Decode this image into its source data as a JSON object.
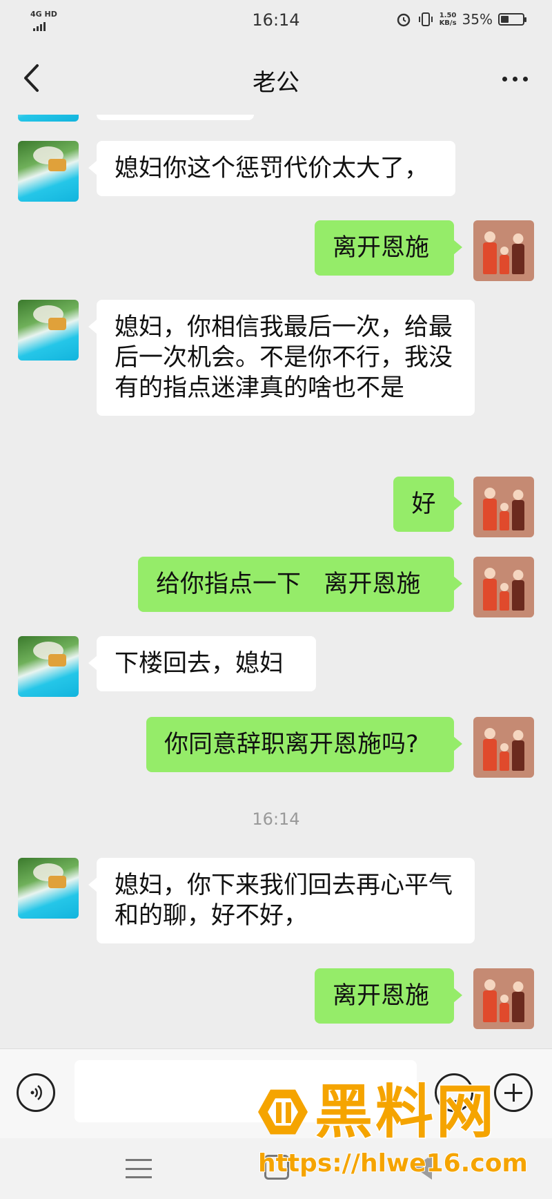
{
  "status_bar": {
    "network": "4G HD",
    "time": "16:14",
    "speed": "1.50\nKB/s",
    "battery": "35%",
    "battery_level": 0.35
  },
  "header": {
    "title": "老公"
  },
  "messages": [
    {
      "sender": "husband",
      "text": "媳妇你这个惩罚代价太大了，"
    },
    {
      "sender": "me",
      "text": "离开恩施"
    },
    {
      "sender": "husband",
      "text": "媳妇，你相信我最后一次，给最后一次机会。不是你不行，我没有的指点迷津真的啥也不是"
    },
    {
      "sender": "me",
      "text": "好"
    },
    {
      "sender": "me",
      "text": "给你指点一下   离开恩施"
    },
    {
      "sender": "husband",
      "text": "下楼回去，媳妇"
    },
    {
      "sender": "me",
      "text": "你同意辞职离开恩施吗?"
    },
    {
      "sender": "husband",
      "text": "媳妇，你下来我们回去再心平气和的聊，好不好，"
    },
    {
      "sender": "me",
      "text": "离开恩施"
    }
  ],
  "timestamp": "16:14",
  "input": {
    "value": ""
  },
  "watermark": {
    "title": "黑料网",
    "url": "https://hlwe16.com"
  },
  "colors": {
    "background": "#ededed",
    "incoming_bubble": "#ffffff",
    "outgoing_bubble": "#95ec69",
    "watermark": "#f5a400"
  }
}
